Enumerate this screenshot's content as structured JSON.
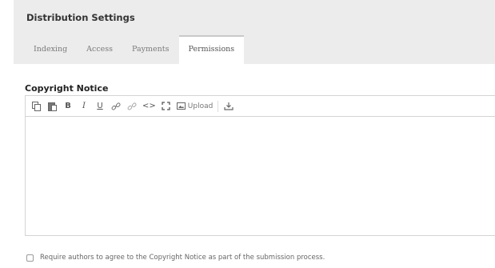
{
  "header": {
    "title": "Distribution Settings",
    "tabs": [
      {
        "label": "Indexing"
      },
      {
        "label": "Access"
      },
      {
        "label": "Payments"
      },
      {
        "label": "Permissions",
        "active": true
      }
    ]
  },
  "copyright": {
    "label": "Copyright Notice",
    "toolbar": {
      "copy_icon": "copy-icon",
      "paste_icon": "paste-icon",
      "bold_label": "B",
      "italic_label": "I",
      "underline_label": "U",
      "link_icon": "link-icon",
      "unlink_icon": "unlink-icon",
      "code_label": "<>",
      "fullscreen_icon": "fullscreen-icon",
      "upload_label": "Upload",
      "import_icon": "import-icon"
    },
    "content": ""
  },
  "agreement": {
    "label": "Require authors to agree to the Copyright Notice as part of the submission process.",
    "checked": false
  },
  "colors": {
    "header_bg": "#ececec",
    "border": "#d4d4d4"
  }
}
